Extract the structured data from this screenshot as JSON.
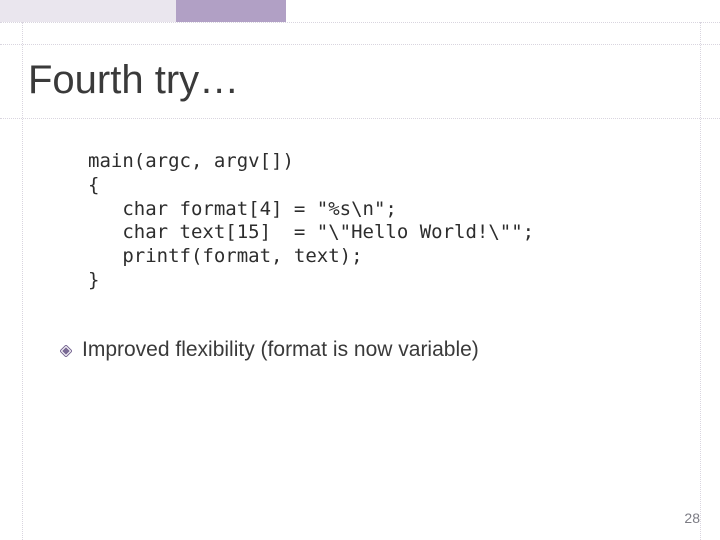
{
  "title": "Fourth try…",
  "code": "main(argc, argv[])\n{\n   char format[4] = \"%s\\n\";\n   char text[15]  = \"\\\"Hello World!\\\"\";\n   printf(format, text);\n}",
  "bullet": "Improved flexibility (format is now variable)",
  "page_number": "28"
}
